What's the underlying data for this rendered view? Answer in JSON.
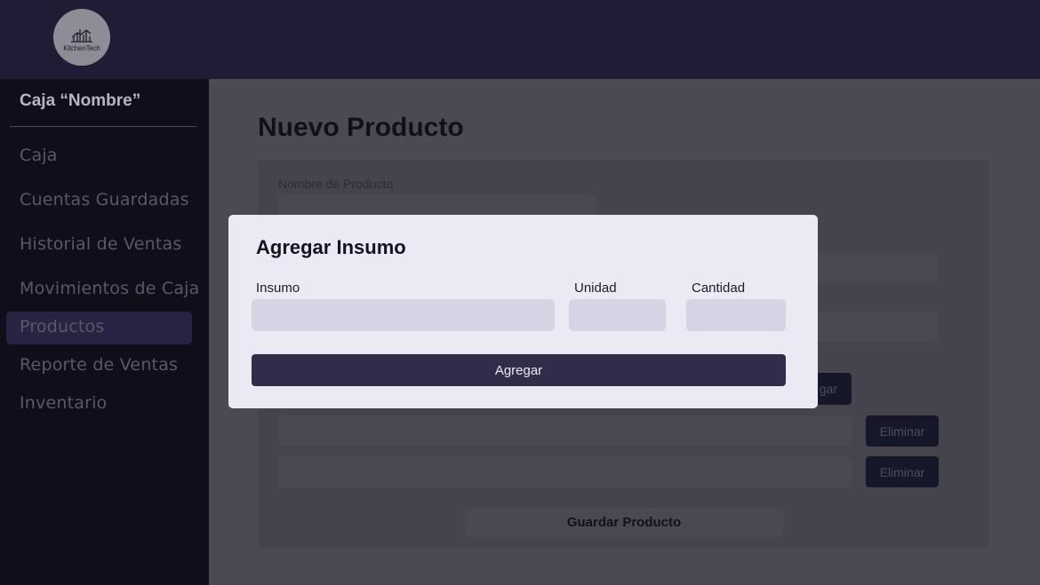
{
  "header": {
    "logo_text": "KitchenTech"
  },
  "sidebar": {
    "title": "Caja “Nombre”",
    "items": [
      {
        "label": "Caja"
      },
      {
        "label": "Cuentas Guardadas"
      },
      {
        "label": "Historial de Ventas"
      },
      {
        "label": "Movimientos de Caja"
      },
      {
        "label": "Productos",
        "active": true
      },
      {
        "label": "Reporte de Ventas"
      },
      {
        "label": "Inventario"
      }
    ]
  },
  "main": {
    "page_title": "Nuevo Producto",
    "form": {
      "product_name_label": "Nombre de Producto",
      "add_button_partial": "gar",
      "delete_label": "Eliminar",
      "save_label": "Guardar Producto"
    }
  },
  "modal": {
    "title": "Agregar Insumo",
    "insumo_label": "Insumo",
    "unidad_label": "Unidad",
    "cantidad_label": "Cantidad",
    "insumo_value": "",
    "unidad_value": "",
    "cantidad_value": "",
    "submit_label": "Agregar"
  },
  "colors": {
    "topbar": "#1f1d36",
    "sidebar": "#0f0f1c",
    "overlay_main": "#4b4a53",
    "modal_bg": "#ebe9f3",
    "modal_input": "#d5d4e5",
    "primary_button": "#2f2d4a"
  }
}
